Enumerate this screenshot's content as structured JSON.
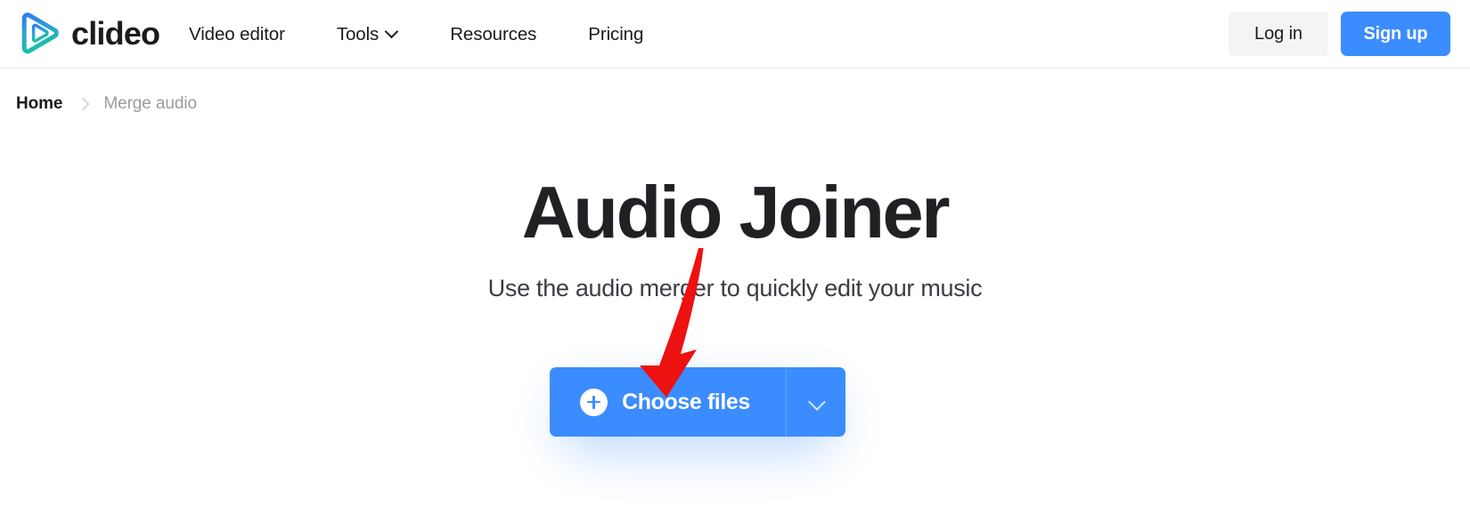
{
  "header": {
    "logo": {
      "icon": "play-triangle-logo-icon",
      "text": "clideo",
      "gradient_from": "#2f80ed",
      "gradient_to": "#18c69a"
    },
    "nav": [
      {
        "label": "Video editor",
        "has_dropdown": false
      },
      {
        "label": "Tools",
        "has_dropdown": true,
        "dropdown_icon": "chevron-down-icon"
      },
      {
        "label": "Resources",
        "has_dropdown": false
      },
      {
        "label": "Pricing",
        "has_dropdown": false
      }
    ],
    "auth": {
      "login_label": "Log in",
      "signup_label": "Sign up",
      "login_bg": "#f4f4f5",
      "signup_bg": "#3b8cff"
    }
  },
  "breadcrumb": {
    "home_label": "Home",
    "separator_icon": "chevron-right-icon",
    "current_label": "Merge audio"
  },
  "hero": {
    "title": "Audio Joiner",
    "subtitle": "Use the audio merger to quickly edit your music"
  },
  "cta": {
    "plus_icon": "plus-circle-icon",
    "label": "Choose files",
    "dropdown_icon": "chevron-down-icon",
    "color": "#3b8cff"
  },
  "annotation": {
    "arrow_icon": "red-down-arrow-icon",
    "color": "#ee1111"
  }
}
